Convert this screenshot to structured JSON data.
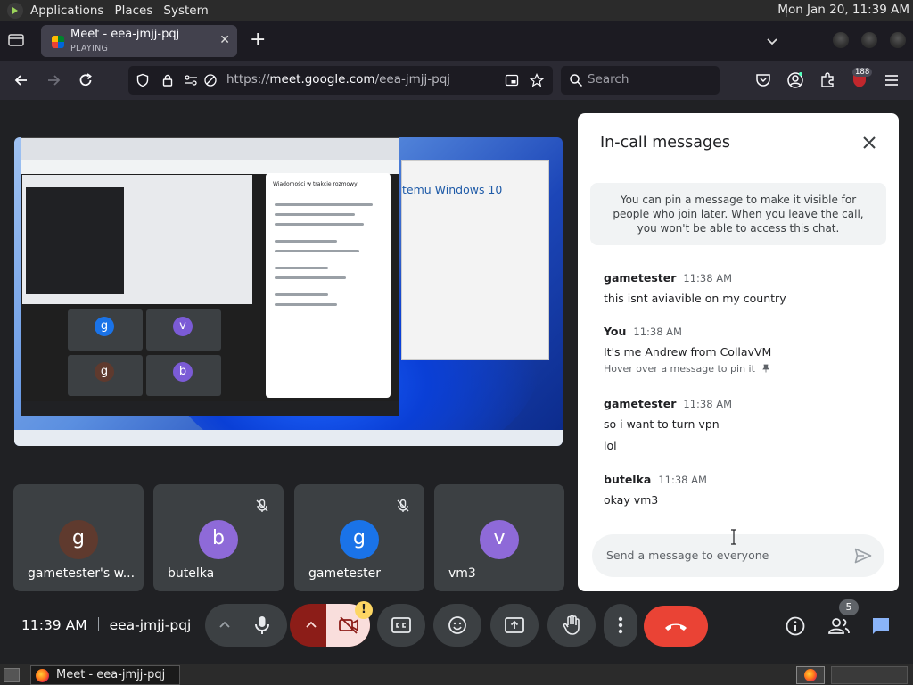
{
  "os_panel": {
    "menus": [
      "Applications",
      "Places",
      "System"
    ],
    "clock": "Mon Jan 20, 11:39 AM"
  },
  "browser": {
    "tab": {
      "title": "Meet - eea-jmjj-pqj",
      "status": "PLAYING"
    },
    "url_prefix": "https://",
    "url_host": "meet.google.com",
    "url_path": "/eea-jmjj-pqj",
    "search_placeholder": "Search",
    "extension_badge": "188"
  },
  "shared_screen": {
    "chat_title": "Wiadomości w trakcie rozmowy",
    "dialog_heading": "temu Windows 10",
    "tiles": [
      {
        "initial": "g",
        "color": "#1a73e8"
      },
      {
        "initial": "v",
        "color": "#7b5bd6"
      },
      {
        "initial": "g",
        "color": "#5f3a2e"
      },
      {
        "initial": "b",
        "color": "#7b5bd6"
      }
    ]
  },
  "participants": [
    {
      "name": "gametester's w...",
      "initial": "g",
      "avatar_color": "#5f3a2e",
      "muted": false
    },
    {
      "name": "butelka",
      "initial": "b",
      "avatar_color": "#8e6ad8",
      "muted": true
    },
    {
      "name": "gametester",
      "initial": "g",
      "avatar_color": "#1a73e8",
      "muted": true
    },
    {
      "name": "vm3",
      "initial": "v",
      "avatar_color": "#8e6ad8",
      "muted": false
    }
  ],
  "chat": {
    "title": "In-call messages",
    "notice": "You can pin a message to make it visible for people who join later. When you leave the call, you won't be able to access this chat.",
    "messages": [
      {
        "sender": "gametester",
        "time": "11:38 AM",
        "lines": [
          "this isnt aviavible on my country"
        ]
      },
      {
        "sender": "You",
        "time": "11:38 AM",
        "lines": [
          "It's me Andrew from CollavVM"
        ],
        "hint": "Hover over a message to pin it"
      },
      {
        "sender": "gametester",
        "time": "11:38 AM",
        "lines": [
          "so i want to turn vpn",
          "lol"
        ]
      },
      {
        "sender": "butelka",
        "time": "11:38 AM",
        "lines": [
          "okay vm3"
        ]
      }
    ],
    "input_placeholder": "Send a message to everyone"
  },
  "controls": {
    "time": "11:39 AM",
    "meeting_code": "eea-jmjj-pqj",
    "camera_warning": "!",
    "participant_count": "5"
  },
  "colors": {
    "end_call": "#ea4335",
    "camera_off": "#f9dedc",
    "accent": "#1a73e8",
    "chat_active": "#8ab4f8"
  },
  "os_taskbar": {
    "task_title": "Meet - eea-jmjj-pqj ..."
  }
}
